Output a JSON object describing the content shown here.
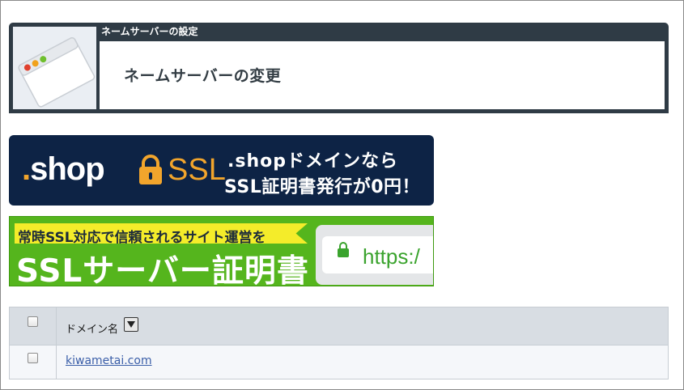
{
  "panel": {
    "caption": "ネームサーバーの設定",
    "title": "ネームサーバーの変更",
    "icon": "browser-window-icon"
  },
  "banners": {
    "shop": {
      "logo_shop": "shop",
      "logo_dot": ".",
      "logo_ssl": "SSL",
      "line1": ".shopドメインなら",
      "line2": "SSL証明書発行が0円！",
      "colors": {
        "background": "#0d2345",
        "accent": "#f2a52c"
      }
    },
    "ssl": {
      "tagline": "常時SSL対応で信頼されるサイト運営を",
      "headline": "SSLサーバー証明書",
      "url_text": "https:/",
      "colors": {
        "background": "#55b51d",
        "tag": "#f4ec2a"
      }
    }
  },
  "table": {
    "columns": [
      {
        "label": "ドメイン名",
        "sort_icon": "sort-down-icon"
      }
    ],
    "rows": [
      {
        "checked": false,
        "domain": "kiwametai.com"
      }
    ]
  }
}
